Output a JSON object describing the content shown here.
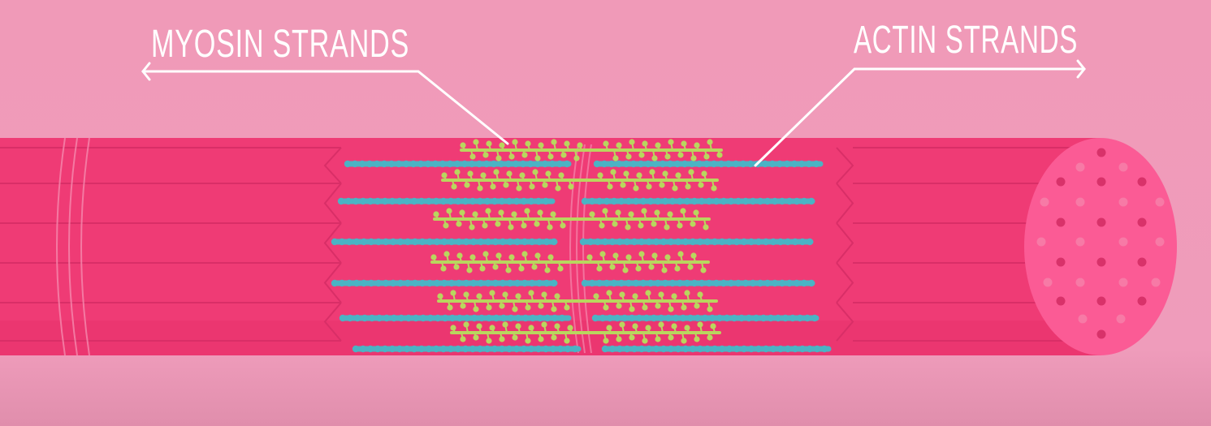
{
  "labels": {
    "myosin": "MYOSIN STRANDS",
    "actin": "ACTIN STRANDS"
  },
  "colors": {
    "background_top": "#f09ab8",
    "background_bottom": "#e290ae",
    "muscle_fiber": "#ef3b75",
    "muscle_fiber_light": "#f25d8c",
    "fiber_lines": "#d92e67",
    "cross_section": "#fb5b95",
    "actin": "#4bb3c4",
    "myosin": "#b9d65e",
    "label_lines": "#ffffff"
  },
  "icons": {
    "cross_section": "circular-cross-section-icon"
  }
}
